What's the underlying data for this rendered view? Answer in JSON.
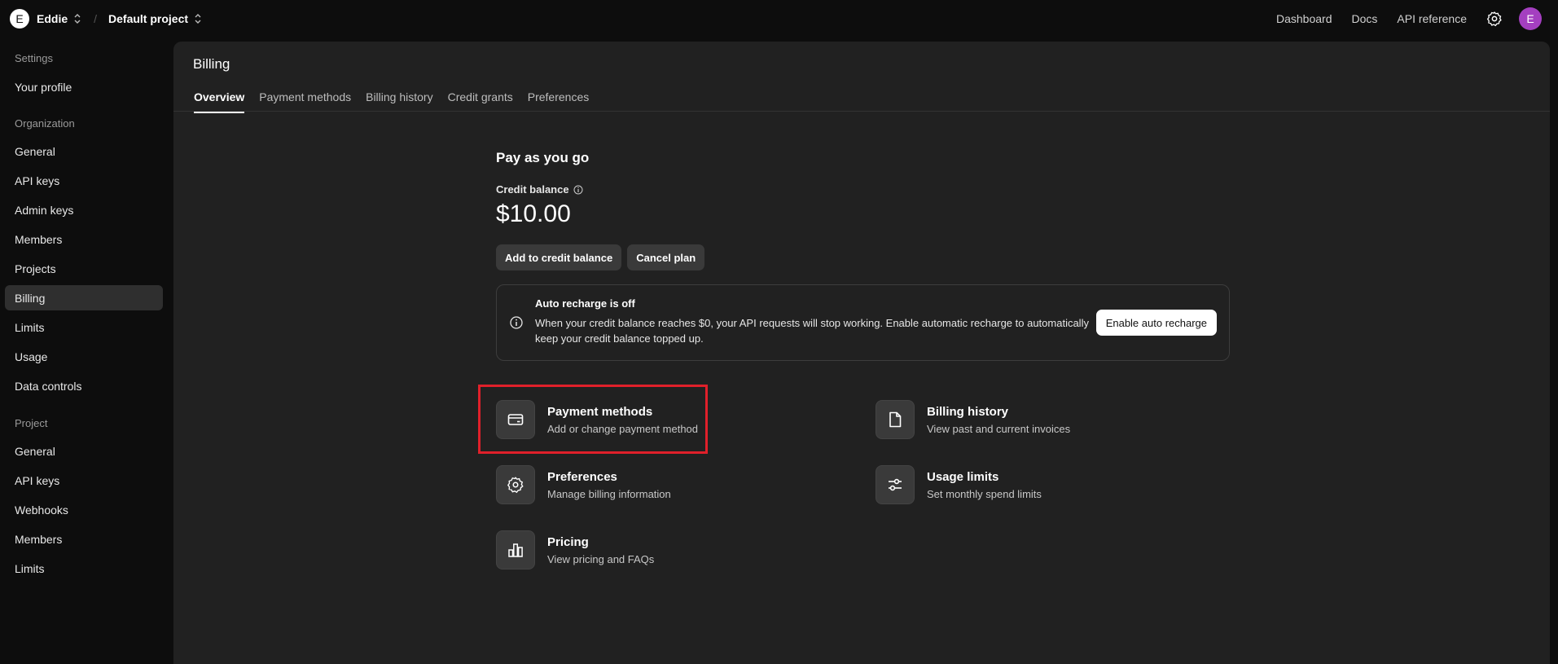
{
  "topbar": {
    "org_initial": "E",
    "org_name": "Eddie",
    "separator": "/",
    "project_name": "Default project",
    "links": [
      "Dashboard",
      "Docs",
      "API reference"
    ],
    "user_initial": "E"
  },
  "sidebar": {
    "sections": [
      {
        "title": "Settings",
        "items": [
          "Your profile"
        ]
      },
      {
        "title": "Organization",
        "items": [
          "General",
          "API keys",
          "Admin keys",
          "Members",
          "Projects",
          "Billing",
          "Limits",
          "Usage",
          "Data controls"
        ]
      },
      {
        "title": "Project",
        "items": [
          "General",
          "API keys",
          "Webhooks",
          "Members",
          "Limits"
        ]
      }
    ],
    "active": "Billing"
  },
  "page": {
    "title": "Billing",
    "tabs": [
      "Overview",
      "Payment methods",
      "Billing history",
      "Credit grants",
      "Preferences"
    ],
    "active_tab": "Overview"
  },
  "plan": {
    "name": "Pay as you go",
    "credit_label": "Credit balance",
    "credit_value": "$10.00",
    "add_credit_label": "Add to credit balance",
    "cancel_label": "Cancel plan"
  },
  "auto_recharge": {
    "title": "Auto recharge is off",
    "description": "When your credit balance reaches $0, your API requests will stop working. Enable automatic recharge to automatically keep your credit balance topped up.",
    "button": "Enable auto recharge"
  },
  "cards": {
    "payment": {
      "title": "Payment methods",
      "sub": "Add or change payment method",
      "icon": "credit-card-icon"
    },
    "history": {
      "title": "Billing history",
      "sub": "View past and current invoices",
      "icon": "document-icon"
    },
    "preferences": {
      "title": "Preferences",
      "sub": "Manage billing information",
      "icon": "gear-icon"
    },
    "limits": {
      "title": "Usage limits",
      "sub": "Set monthly spend limits",
      "icon": "sliders-icon"
    },
    "pricing": {
      "title": "Pricing",
      "sub": "View pricing and FAQs",
      "icon": "bar-chart-icon"
    }
  },
  "colors": {
    "highlight": "#e0202a",
    "user_avatar": "#a43fc0"
  }
}
